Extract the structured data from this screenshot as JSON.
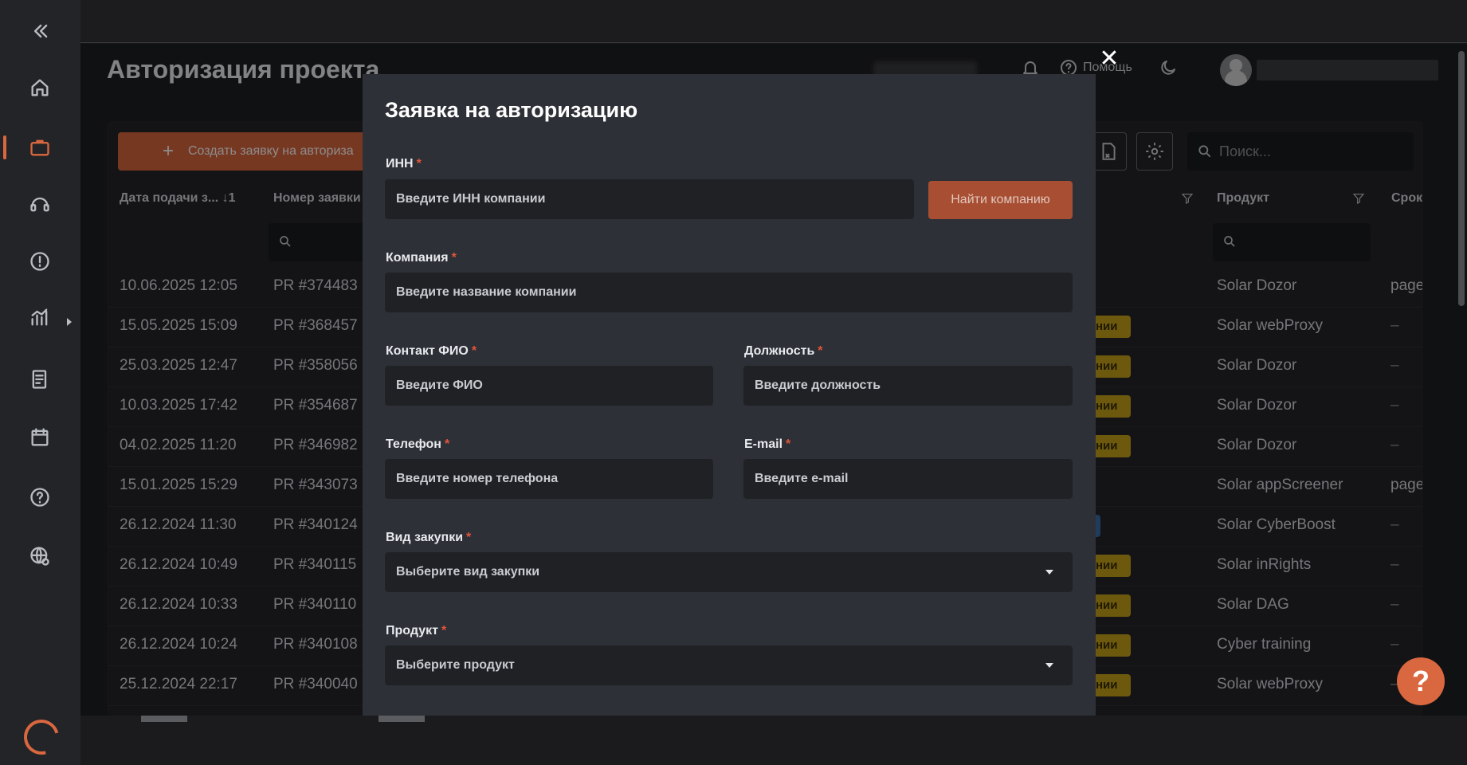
{
  "page": {
    "title": "Авторизация проекта",
    "help_label": "Помощь",
    "create_button": "Создать заявку на авториза",
    "search_placeholder": "Поиск..."
  },
  "table": {
    "headers": {
      "date": "Дата подачи з...  ↓1",
      "number": "Номер заявки",
      "product": "Продукт",
      "term": "Срок"
    },
    "rows": [
      {
        "date": "10.06.2025 12:05",
        "number": "PR #374483",
        "badge": "",
        "product": "Solar Dozor",
        "term": "page"
      },
      {
        "date": "15.05.2025 15:09",
        "number": "PR #368457",
        "badge": "нии",
        "product": "Solar webProxy",
        "term": "–"
      },
      {
        "date": "25.03.2025 12:47",
        "number": "PR #358056",
        "badge": "нии",
        "product": "Solar Dozor",
        "term": "–"
      },
      {
        "date": "10.03.2025 17:42",
        "number": "PR #354687",
        "badge": "нии",
        "product": "Solar Dozor",
        "term": "–"
      },
      {
        "date": "04.02.2025 11:20",
        "number": "PR #346982",
        "badge": "нии",
        "product": "Solar Dozor",
        "term": "–"
      },
      {
        "date": "15.01.2025 15:29",
        "number": "PR #343073",
        "badge": "",
        "product": "Solar appScreener",
        "term": "page"
      },
      {
        "date": "26.12.2024 11:30",
        "number": "PR #340124",
        "badge": "",
        "product": "Solar CyberBoost",
        "term": "–"
      },
      {
        "date": "26.12.2024 10:49",
        "number": "PR #340115",
        "badge": "нии",
        "product": "Solar inRights",
        "term": "–"
      },
      {
        "date": "26.12.2024 10:33",
        "number": "PR #340110",
        "badge": "нии",
        "product": "Solar DAG",
        "term": "–"
      },
      {
        "date": "26.12.2024 10:24",
        "number": "PR #340108",
        "badge": "нии",
        "product": "Cyber training",
        "term": "–"
      },
      {
        "date": "25.12.2024 22:17",
        "number": "PR #340040",
        "badge": "нии",
        "product": "Solar webProxy",
        "term": "–"
      }
    ]
  },
  "modal": {
    "title": "Заявка на авторизацию",
    "required_mark": "*",
    "inn": {
      "label": "ИНН",
      "placeholder": "Введите ИНН компании"
    },
    "find_button": "Найти компанию",
    "company": {
      "label": "Компания",
      "placeholder": "Введите название компании"
    },
    "contact": {
      "label": "Контакт ФИО",
      "placeholder": "Введите ФИО"
    },
    "position": {
      "label": "Должность",
      "placeholder": "Введите должность"
    },
    "phone": {
      "label": "Телефон",
      "placeholder": "Введите номер телефона"
    },
    "email": {
      "label": "E-mail",
      "placeholder": "Введите e-mail"
    },
    "purchase": {
      "label": "Вид закупки",
      "placeholder": "Выберите вид закупки"
    },
    "product": {
      "label": "Продукт",
      "placeholder": "Выберите продукт"
    },
    "close": "✕"
  },
  "help_fab": "?",
  "colors": {
    "accent": "#d9673f",
    "badge": "#c6a21a",
    "modal_bg": "#2d3036",
    "input_bg": "#1f2125",
    "required": "#e0553a"
  },
  "icons": {
    "sidebar": [
      "collapse-icon",
      "home-icon",
      "briefcase-icon",
      "support-icon",
      "alert-icon",
      "analytics-icon",
      "report-icon",
      "calendar-icon",
      "help-icon",
      "settings-globe-icon"
    ]
  }
}
